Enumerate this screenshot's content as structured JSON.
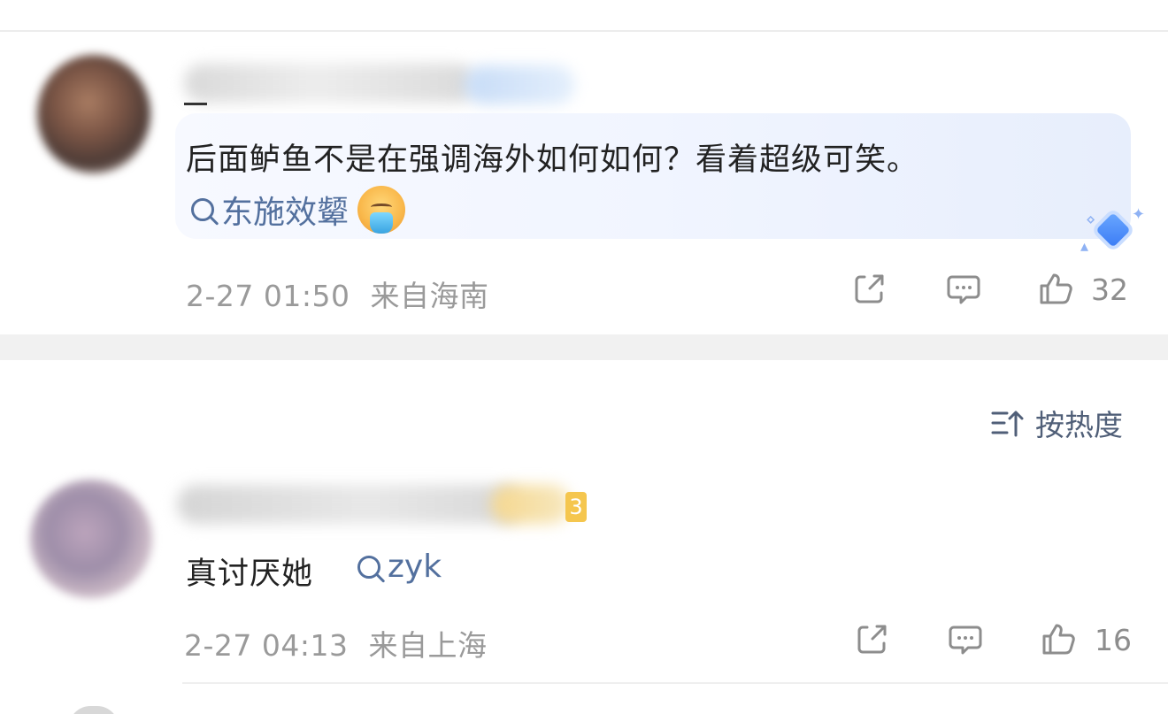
{
  "comments": [
    {
      "text": "后面鲈鱼不是在强调海外如何如何？看着超级可笑。",
      "tag": "东施效颦",
      "time": "2-27 01:50",
      "location": "来自海南",
      "likes": "32"
    },
    {
      "text": "真讨厌她",
      "tag": "zyk",
      "time": "2-27 04:13",
      "location": "来自上海",
      "likes": "16",
      "level": "3"
    }
  ],
  "sort": {
    "label": "按热度"
  },
  "colors": {
    "accent_blue": "#53709e",
    "meta_gray": "#9a9a9a",
    "badge_yellow": "#f5c64e"
  },
  "icons": {
    "share": "share-icon",
    "comment": "comment-icon",
    "like": "thumbs-up-icon",
    "search": "search-icon",
    "emoji": "vomiting-face-icon",
    "sort": "sort-icon",
    "badge": "diamond-badge-icon"
  }
}
